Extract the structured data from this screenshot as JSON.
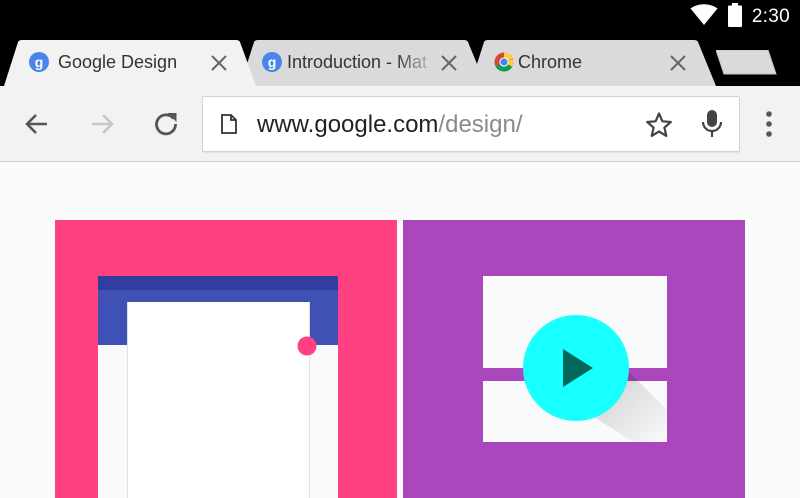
{
  "status_bar": {
    "time": "2:30",
    "icons": [
      "wifi-icon",
      "battery-icon"
    ]
  },
  "tabs": [
    {
      "title": "Google Design",
      "favicon": "google-design-favicon",
      "active": true
    },
    {
      "title": "Introduction - Mat",
      "favicon": "google-design-favicon",
      "active": false
    },
    {
      "title": "Chrome",
      "favicon": "chrome-favicon",
      "active": false
    }
  ],
  "toolbar": {
    "url_host": "www.google.com",
    "url_path": "/design/",
    "icons": [
      "back-arrow-icon",
      "forward-arrow-icon",
      "reload-icon",
      "page-icon",
      "star-icon",
      "mic-icon",
      "more-vert-icon"
    ]
  },
  "colors": {
    "pink": "#ff4081",
    "purple": "#ab47bc",
    "indigo": "#3f51b5",
    "cyan": "#00e5ff",
    "teal_dark": "#00695c"
  }
}
